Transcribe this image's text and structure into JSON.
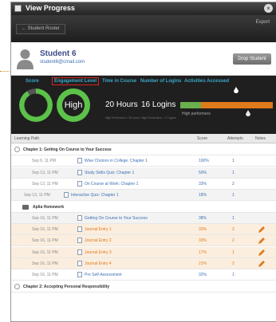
{
  "window": {
    "title": "View Progress",
    "close_glyph": "×"
  },
  "toolbar": {
    "roster_label": "← Student Roster",
    "export_label": "Export"
  },
  "student": {
    "name": "Student 6",
    "email": "student6@cmail.com",
    "drop_label": "Drop Student"
  },
  "metric_tabs": [
    "Score",
    "Engagement Level",
    "Time in Course",
    "Number of Logins",
    "Activities Accessed"
  ],
  "selected_tab": "Engagement Level",
  "metrics": {
    "score_value": "91%",
    "score_fraction": 0.91,
    "engagement_value": "High",
    "time_value": "20 Hours",
    "time_note": "High Performers = 30 hours",
    "logins_value": "16 Logins",
    "logins_note": "High Performers = 17 logins",
    "performers_label": "High performers"
  },
  "colors": {
    "ring_green": "#5cc24a",
    "accent_blue": "#3aa8c8",
    "orange": "#e07a1b",
    "highlight_red": "#d22222"
  },
  "table": {
    "headers": {
      "path": "Learning Path",
      "score": "Score",
      "attempts": "Attempts",
      "notes": "Notes"
    },
    "rows": [
      {
        "kind": "section",
        "title": "Chapter 1: Getting On Course to Your Success"
      },
      {
        "kind": "item",
        "date": "Sep 6, 11 PM",
        "activity": "Wise Choices in College: Chapter 1",
        "score": "100%",
        "attempts": "1",
        "note": false,
        "orange": false
      },
      {
        "kind": "item",
        "date": "Sep 13, 11 PM",
        "activity": "Study Skills Quiz: Chapter 1",
        "score": "50%",
        "attempts": "1",
        "note": false,
        "orange": false
      },
      {
        "kind": "item",
        "date": "Sep 13, 11 PM",
        "activity": "On Course at Work: Chapter 1",
        "score": "33%",
        "attempts": "2",
        "note": false,
        "orange": false
      },
      {
        "kind": "item-shallow",
        "date": "Sep 13, 11 PM",
        "activity": "Interactive Quiz: Chapter 1",
        "score": "18%",
        "attempts": "1",
        "note": false,
        "orange": false
      },
      {
        "kind": "folder",
        "title": "Aplia Homework"
      },
      {
        "kind": "item",
        "date": "Sep 16, 11 PM",
        "activity": "Getting On Course to Your Success",
        "score": "38%",
        "attempts": "1",
        "note": false,
        "orange": false
      },
      {
        "kind": "item",
        "date": "Sep 16, 11 PM",
        "activity": "Journal Entry 1",
        "score": "33%",
        "attempts": "2",
        "note": true,
        "orange": true
      },
      {
        "kind": "item",
        "date": "Sep 16, 11 PM",
        "activity": "Journal Entry 2",
        "score": "33%",
        "attempts": "2",
        "note": true,
        "orange": true
      },
      {
        "kind": "item",
        "date": "Sep 16, 11 PM",
        "activity": "Journal Entry 3",
        "score": "17%",
        "attempts": "1",
        "note": true,
        "orange": true
      },
      {
        "kind": "item",
        "date": "Sep 16, 11 PM",
        "activity": "Journal Entry 4",
        "score": "21%",
        "attempts": "2",
        "note": true,
        "orange": true
      },
      {
        "kind": "item",
        "date": "Sep 16, 11 PM",
        "activity": "Pre Self-Assessment",
        "score": "32%",
        "attempts": "1",
        "note": false,
        "orange": false
      },
      {
        "kind": "section",
        "title": "Chapter 2: Accepting Personal Responsibility"
      }
    ]
  }
}
